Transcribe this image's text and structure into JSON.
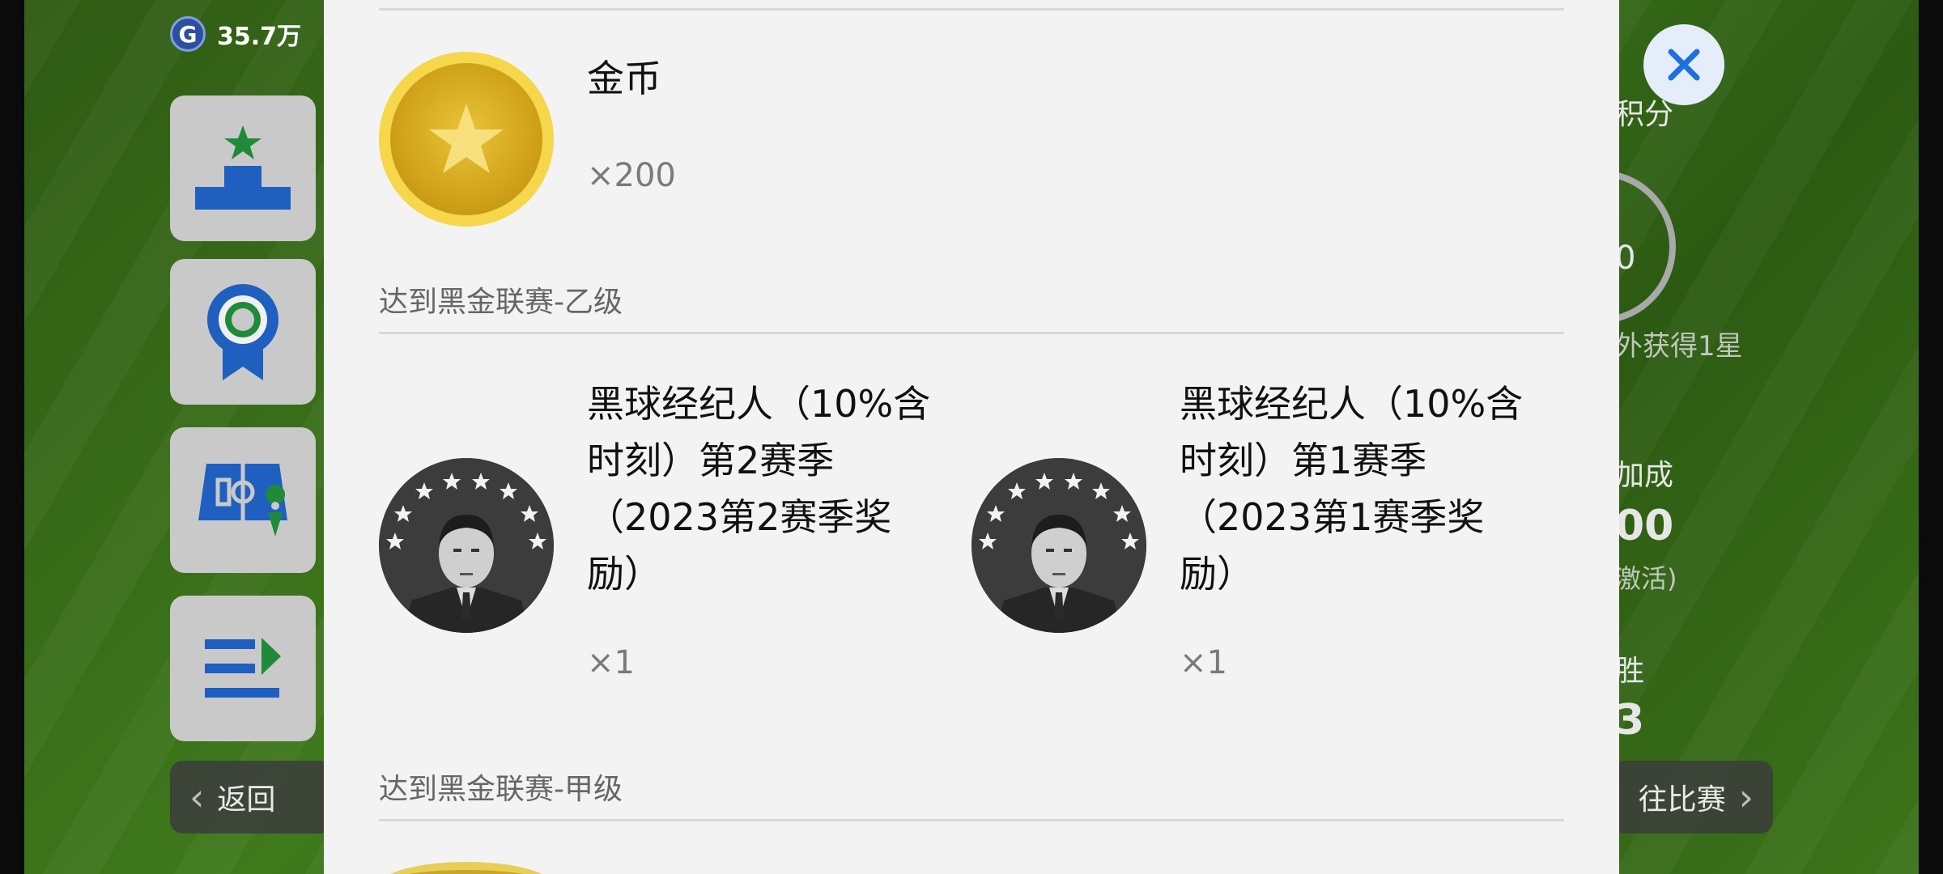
{
  "status": {
    "coin_amount": "35.7万",
    "currency_badge": "G"
  },
  "nav": {
    "back_label": "返回",
    "go_match_label": "往比赛"
  },
  "background_peek": {
    "points_label": "积分",
    "ring_value": "0",
    "extra_star": "外获得1星",
    "bonus_label": "加成",
    "bonus_value": "00",
    "activate_note": "激活)",
    "wins_label": "胜",
    "wins_value": "3"
  },
  "modal": {
    "first_reward": {
      "name": "金币",
      "qty": "×200",
      "icon": "gold-coin-icon"
    },
    "sections": [
      {
        "title": "达到黑金联赛-乙级",
        "rewards": [
          {
            "name_lines": [
              "黑球经纪人（10%含",
              "时刻）第2赛季",
              "（2023第2赛季奖",
              "励）"
            ],
            "qty": "×1",
            "icon": "agent-avatar-icon"
          },
          {
            "name_lines": [
              "黑球经纪人（10%含",
              "时刻）第1赛季",
              "（2023第1赛季奖",
              "励）"
            ],
            "qty": "×1",
            "icon": "agent-avatar-icon"
          }
        ]
      },
      {
        "title": "达到黑金联赛-甲级",
        "rewards": []
      }
    ]
  },
  "colors": {
    "accent_blue": "#1f5fbf",
    "star_green": "#1e8a3a",
    "gold": "#e0b92a",
    "modal_bg": "#f3f3f3"
  }
}
